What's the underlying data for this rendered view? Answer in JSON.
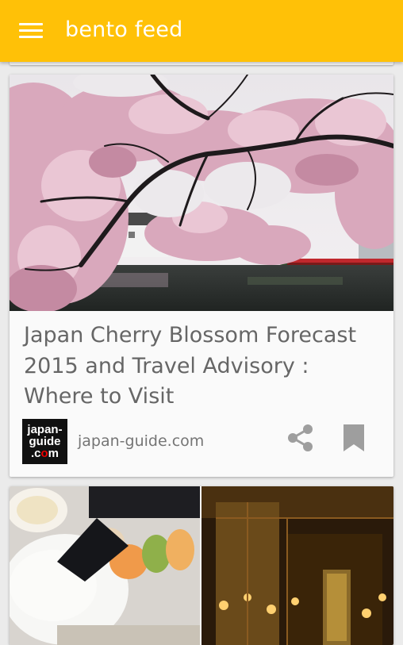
{
  "app": {
    "title": "bento feed",
    "accent_color": "#ffc107"
  },
  "icons": {
    "menu": "hamburger-menu-icon",
    "share": "share-icon",
    "bookmark": "bookmark-icon"
  },
  "feed": {
    "cards": [
      {
        "title": "Japan Cherry Blossom Forecast 2015 and Travel Advisory : Where to Visit",
        "source": "japan-guide.com",
        "logo_text": {
          "line1": "japan-",
          "line2": "guide",
          "line3_before": ".c",
          "line3_dot": "o",
          "line3_after": "m"
        }
      }
    ]
  }
}
